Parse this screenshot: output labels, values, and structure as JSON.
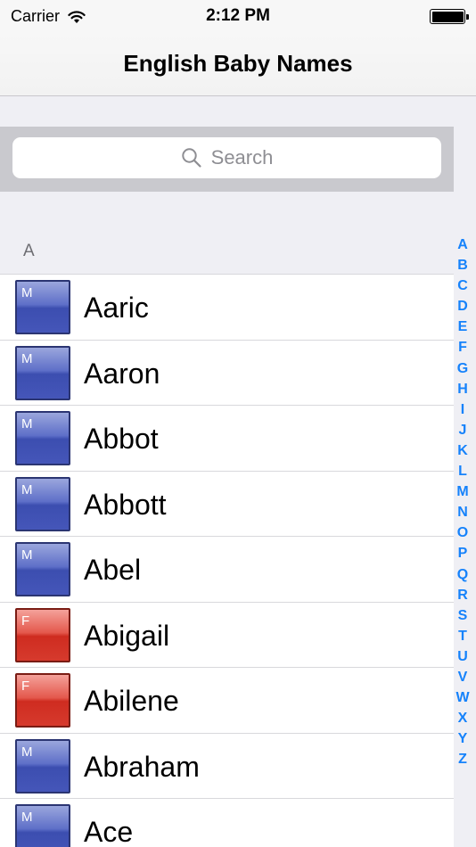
{
  "status": {
    "carrier": "Carrier",
    "time": "2:12 PM"
  },
  "nav": {
    "title": "English Baby Names"
  },
  "search": {
    "placeholder": "Search"
  },
  "section": {
    "letter": "A"
  },
  "rows": [
    {
      "gender": "M",
      "name": "Aaric"
    },
    {
      "gender": "M",
      "name": "Aaron"
    },
    {
      "gender": "M",
      "name": "Abbot"
    },
    {
      "gender": "M",
      "name": "Abbott"
    },
    {
      "gender": "M",
      "name": "Abel"
    },
    {
      "gender": "F",
      "name": "Abigail"
    },
    {
      "gender": "F",
      "name": "Abilene"
    },
    {
      "gender": "M",
      "name": "Abraham"
    },
    {
      "gender": "M",
      "name": "Ace"
    }
  ],
  "index": [
    "A",
    "B",
    "C",
    "D",
    "E",
    "F",
    "G",
    "H",
    "I",
    "J",
    "K",
    "L",
    "M",
    "N",
    "O",
    "P",
    "Q",
    "R",
    "S",
    "T",
    "U",
    "V",
    "W",
    "X",
    "Y",
    "Z"
  ],
  "colors": {
    "accent": "#1582fb",
    "male": "#4556b9",
    "female": "#d63a2d"
  }
}
